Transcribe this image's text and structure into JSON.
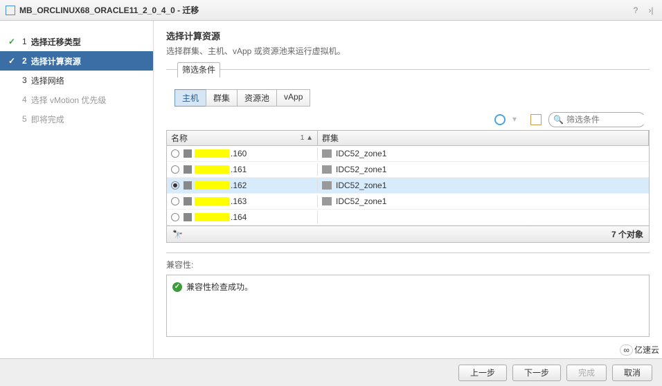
{
  "title": "MB_ORCLINUX68_ORACLE11_2_0_4_0 - 迁移",
  "steps": [
    {
      "num": "1",
      "label": "选择迁移类型"
    },
    {
      "num": "2",
      "label": "选择计算资源"
    },
    {
      "num": "3",
      "label": "选择网络"
    },
    {
      "num": "4",
      "label": "选择 vMotion 优先级"
    },
    {
      "num": "5",
      "label": "即将完成"
    }
  ],
  "heading": "选择计算资源",
  "desc": "选择群集、主机、vApp 或资源池来运行虚拟机。",
  "filter_tab": "筛选条件",
  "subtabs": [
    "主机",
    "群集",
    "资源池",
    "vApp"
  ],
  "filter_placeholder": "筛选条件",
  "cols": {
    "name": "名称",
    "sort": "1 ▲",
    "cluster": "群集"
  },
  "rows": [
    {
      "ip": ".160",
      "cluster": "IDC52_zone1",
      "sel": false,
      "showCluster": true
    },
    {
      "ip": ".161",
      "cluster": "IDC52_zone1",
      "sel": false,
      "showCluster": true
    },
    {
      "ip": ".162",
      "cluster": "IDC52_zone1",
      "sel": true,
      "showCluster": true
    },
    {
      "ip": ".163",
      "cluster": "IDC52_zone1",
      "sel": false,
      "showCluster": true
    },
    {
      "ip": ".164",
      "cluster": "",
      "sel": false,
      "showCluster": false
    }
  ],
  "obj_count": "7 个对象",
  "compat_label": "兼容性:",
  "compat_msg": "兼容性检查成功。",
  "buttons": {
    "back": "上一步",
    "next": "下一步",
    "finish": "完成",
    "cancel": "取消"
  },
  "watermark": "亿速云"
}
